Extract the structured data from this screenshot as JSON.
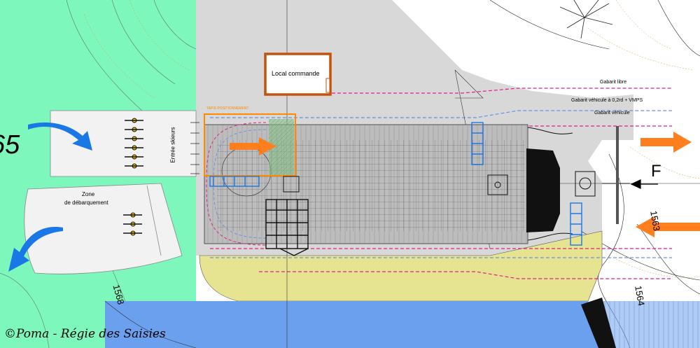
{
  "labels": {
    "local_commande": "Local commande",
    "tapis_positionnement": "TAPIS POSITIONNEMENT",
    "entree_skieurs": "Entrée skieurs",
    "zone_line1": "Zone",
    "zone_line2": "de débarquement",
    "gabarit_libre": "Gabarit libre",
    "gabarit_vehicule_vmps": "Gabarit véhicule à 0,2rd + VMPS",
    "gabarit_vehicule": "Gabarit véhicule",
    "f_marker": "F",
    "contour_1568": "1568",
    "contour_1564": "1564",
    "contour_1563": "1563",
    "big_number": "65",
    "copyright": "©Poma - Régie des Saisies"
  },
  "colors": {
    "green_zone": "#7ef7bc",
    "grey_area": "#d8d8d8",
    "yellow_area": "#e6e491",
    "water_blue": "#6aa0ee",
    "flow_arrow_blue": "#1a78e6",
    "orange_arrow": "#ff7f1e",
    "orange_frame": "#ff8a00",
    "pink_line": "#e0208a",
    "blue_line": "#6f8fe8",
    "contour_brown": "#d2a050"
  },
  "icons": {
    "skier_group": "skier-group-icon",
    "wave_arrow": "curved-flow-arrow-icon",
    "straight_arrow": "direction-arrow-icon"
  }
}
